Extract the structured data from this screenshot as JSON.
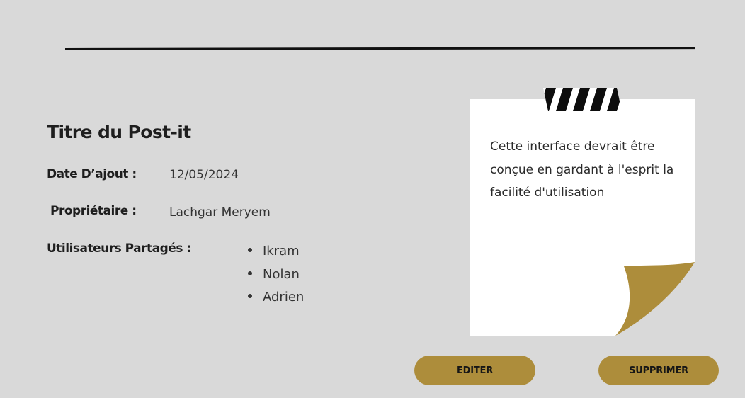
{
  "postit": {
    "title": "Titre du Post-it",
    "date_label": "Date D’ajout :",
    "date_value": "12/05/2024",
    "owner_label": "Propriétaire :",
    "owner_value": "Lachgar Meryem",
    "shared_label": "Utilisateurs Partagés :",
    "shared_users": [
      "Ikram",
      "Nolan",
      "Adrien"
    ]
  },
  "note": {
    "text": "Cette interface devrait être conçue en gardant à l'esprit la facilité d'utilisation"
  },
  "actions": {
    "edit_label": "EDITER",
    "delete_label": "SUPPRIMER"
  },
  "colors": {
    "background": "#d9d9d9",
    "accent_gold": "#ad8d3b",
    "note_paper": "#ffffff",
    "divider": "#111111"
  },
  "icons": {
    "tape": "striped-tape-icon",
    "page_curl": "page-curl-icon",
    "bullet": "bullet-dot-icon"
  }
}
